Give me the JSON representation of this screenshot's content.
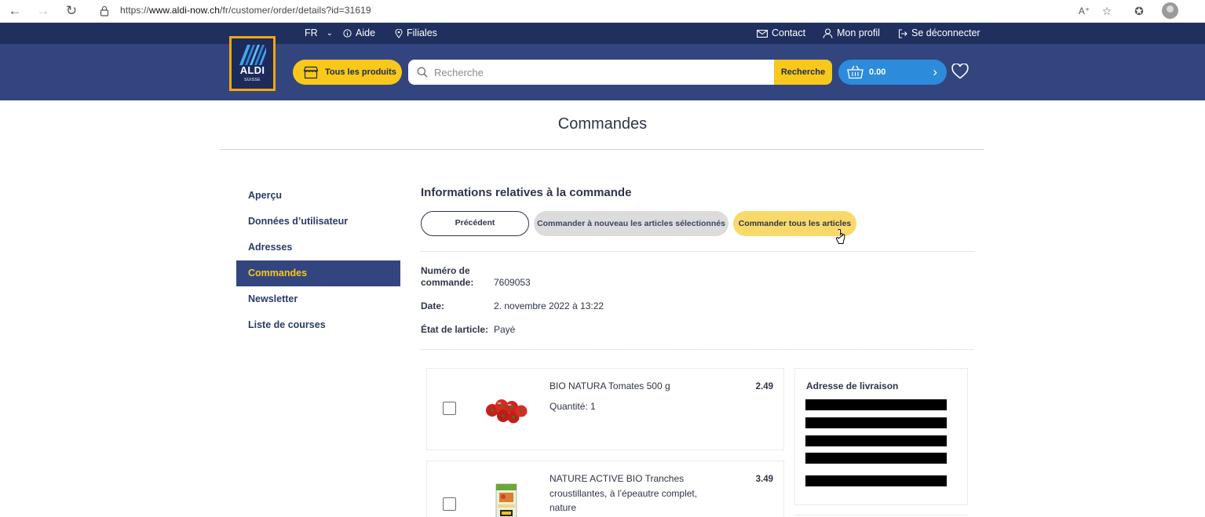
{
  "browser": {
    "url_prefix": "https://",
    "url_host": "www.aldi-now.ch",
    "url_path": "/fr/customer/order/details?id=31619",
    "icons": [
      "back-icon",
      "forward-icon",
      "refresh-icon",
      "lock-icon",
      "read-aloud-icon",
      "add-favorite-icon",
      "favorites-icon",
      "profile-icon"
    ]
  },
  "topbar": {
    "language": "FR",
    "help": "Aide",
    "stores": "Filiales",
    "contact": "Contact",
    "profile": "Mon profil",
    "logout": "Se déconnecter"
  },
  "logo": {
    "name": "ALDI",
    "sub": "SUISSE"
  },
  "header": {
    "products_label": "Tous les produits",
    "search_placeholder": "Recherche",
    "search_button": "Recherche",
    "cart_total": "0.00"
  },
  "page": {
    "title": "Commandes"
  },
  "sidebar": {
    "items": [
      {
        "label": "Aperçu",
        "active": false
      },
      {
        "label": "Données d’utilisateur",
        "active": false
      },
      {
        "label": "Adresses",
        "active": false
      },
      {
        "label": "Commandes",
        "active": true
      },
      {
        "label": "Newsletter",
        "active": false
      },
      {
        "label": "Liste de courses",
        "active": false
      }
    ]
  },
  "order": {
    "section_title": "Informations relatives à la commande",
    "buttons": {
      "previous": "Précédent",
      "reorder_selected": "Commander à nouveau les articles sélectionnés",
      "reorder_all": "Commander tous les articles"
    },
    "number_label_line1": "Numéro de",
    "number_label_line2": "commande:",
    "number_value": "7609053",
    "date_label": "Date:",
    "date_value": "2. novembre 2022 à 13:22",
    "status_label": "État de larticle:",
    "status_value": "Payé"
  },
  "items": [
    {
      "name": "BIO NATURA Tomates 500 g",
      "quantity": "Quantité: 1",
      "price": "2.49",
      "checked": false
    },
    {
      "name_line1": "NATURE ACTIVE BIO Tranches",
      "name_line2": "croustillantes, à l’épeautre complet,",
      "name_line3": "nature",
      "price": "3.49",
      "checked": false
    }
  ],
  "delivery": {
    "title": "Adresse de livraison"
  },
  "colors": {
    "navy": "#1f2f5e",
    "header_blue": "#33457f",
    "yellow": "#f8c81b",
    "cart_blue": "#2d8bdb",
    "logo_orange": "#f6a512"
  }
}
